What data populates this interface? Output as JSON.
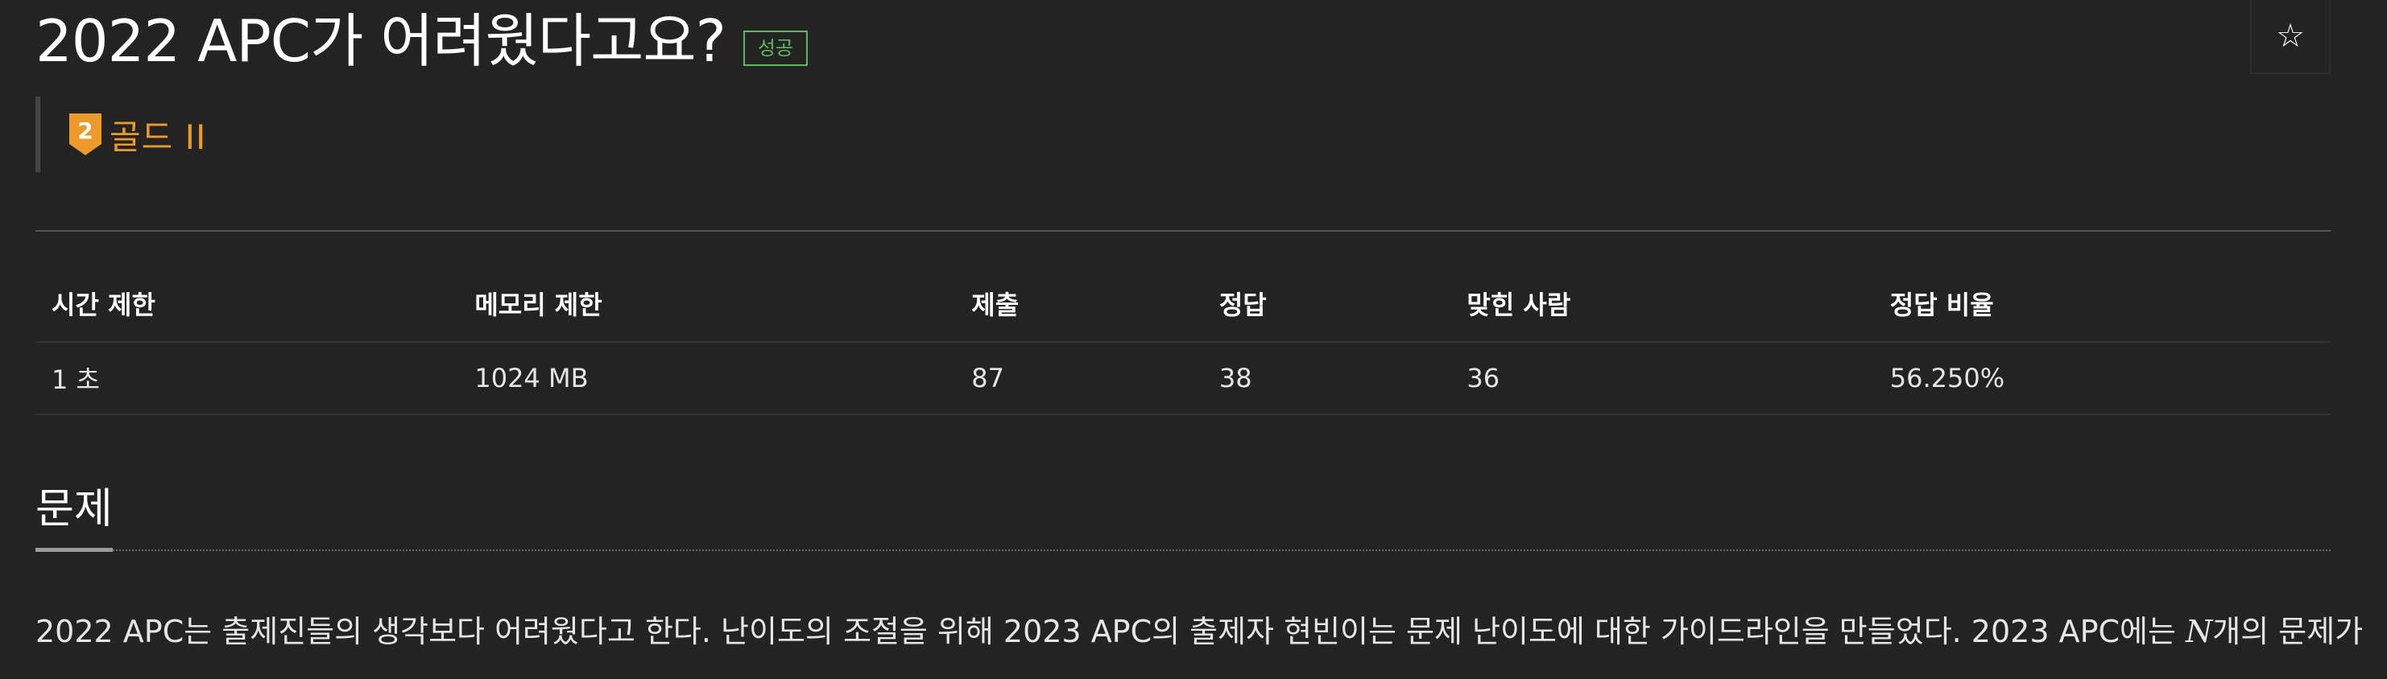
{
  "problem": {
    "title": "2022 APC가 어려웠다고요?",
    "status_badge": "성공",
    "star_icon": "☆",
    "tier": {
      "number": "2",
      "label": "골드 II",
      "color": "#ec9a29"
    }
  },
  "info_table": {
    "headers": [
      "시간 제한",
      "메모리 제한",
      "제출",
      "정답",
      "맞힌 사람",
      "정답 비율"
    ],
    "values": [
      "1 초",
      "1024 MB",
      "87",
      "38",
      "36",
      "56.250%"
    ]
  },
  "section": {
    "heading": "문제",
    "description_before": "2022 APC는 출제진들의 생각보다 어려웠다고 한다. 난이도의 조절을 위해 2023 APC의 출제자 현빈이는 문제 난이도에 대한 가이드라인을 만들었다. 2023 APC에는 ",
    "math_var": "N",
    "description_after": "개의 문제가"
  },
  "colors": {
    "background": "#232323",
    "success": "#5cb85c",
    "gold": "#ec9a29"
  }
}
